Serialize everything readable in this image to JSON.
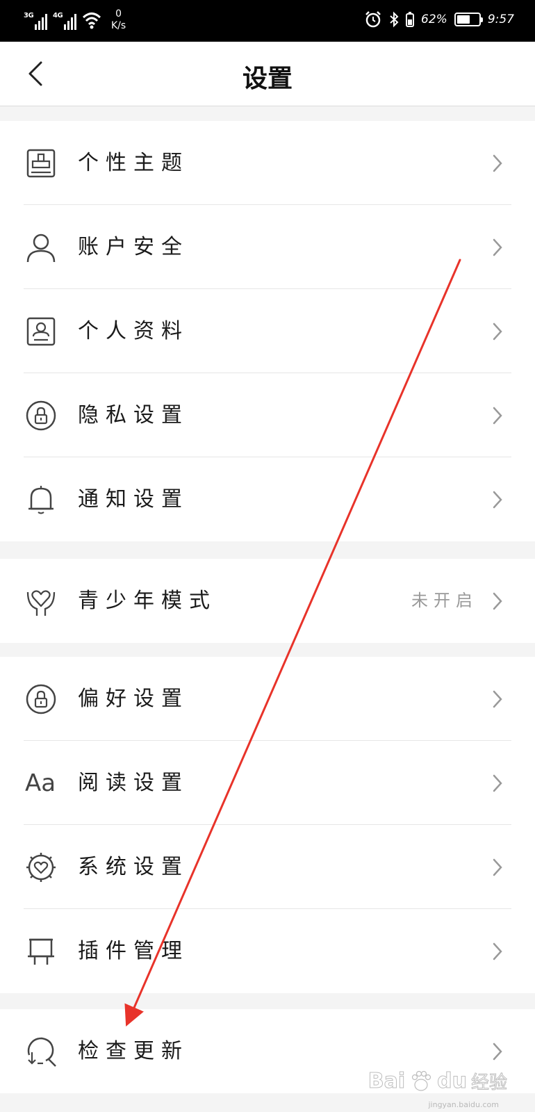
{
  "status_bar": {
    "net1": "3G",
    "net2": "4G",
    "speed_value": "0",
    "speed_unit": "K/s",
    "battery_percent": "62%",
    "battery_level": 0.62,
    "time": "9:57"
  },
  "header": {
    "title": "设置"
  },
  "groups": [
    {
      "items": [
        {
          "label": "个性主题",
          "icon": "theme-icon"
        },
        {
          "label": "账户安全",
          "icon": "user-icon"
        },
        {
          "label": "个人资料",
          "icon": "profile-card-icon"
        },
        {
          "label": "隐私设置",
          "icon": "lock-icon"
        },
        {
          "label": "通知设置",
          "icon": "bell-icon"
        }
      ]
    },
    {
      "items": [
        {
          "label": "青少年模式",
          "value": "未开启",
          "icon": "heart-hands-icon"
        }
      ]
    },
    {
      "items": [
        {
          "label": "偏好设置",
          "icon": "lock-icon"
        },
        {
          "label": "阅读设置",
          "icon": "font-icon",
          "icon_text": "Aa"
        },
        {
          "label": "系统设置",
          "icon": "gear-heart-icon"
        },
        {
          "label": "插件管理",
          "icon": "plugin-icon"
        }
      ]
    },
    {
      "items": [
        {
          "label": "检查更新",
          "icon": "search-update-icon"
        }
      ]
    }
  ],
  "annotation": {
    "color": "#e8332a"
  },
  "watermark": {
    "brand": "Bai",
    "brand_suffix": "du",
    "cn": "经验",
    "url": "jingyan.baidu.com"
  }
}
